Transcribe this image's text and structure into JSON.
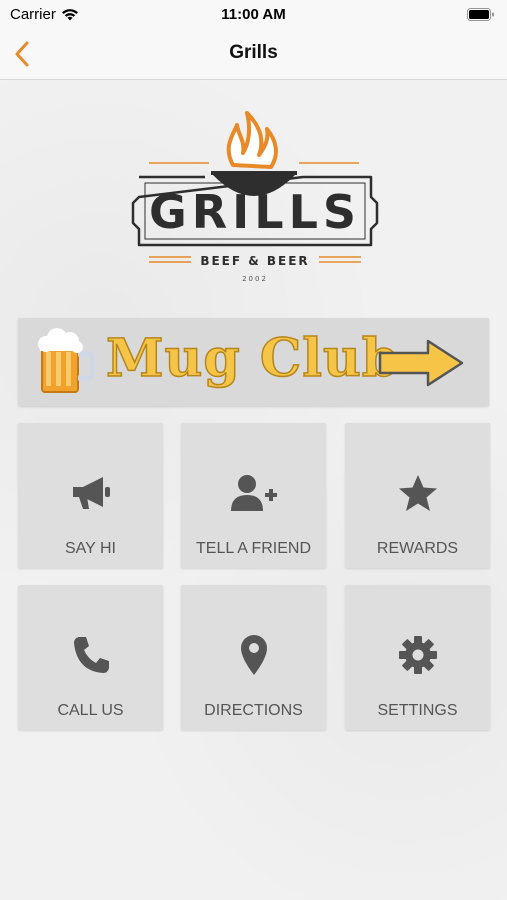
{
  "status_bar": {
    "carrier": "Carrier",
    "time": "11:00 AM"
  },
  "nav": {
    "title": "Grills",
    "back_icon": "chevron-left-icon"
  },
  "logo": {
    "name": "GRILLS",
    "tagline": "BEEF & BEER",
    "year": "2002"
  },
  "banner": {
    "label": "Mug Club"
  },
  "tiles": [
    {
      "label": "SAY HI",
      "icon": "megaphone-icon"
    },
    {
      "label": "TELL A FRIEND",
      "icon": "add-user-icon"
    },
    {
      "label": "REWARDS",
      "icon": "star-icon"
    },
    {
      "label": "CALL US",
      "icon": "phone-icon"
    },
    {
      "label": "DIRECTIONS",
      "icon": "map-pin-icon"
    },
    {
      "label": "SETTINGS",
      "icon": "gear-icon"
    }
  ],
  "colors": {
    "accent": "#e78a27",
    "banner_text": "#f6c548",
    "tile_icon": "#555555"
  }
}
